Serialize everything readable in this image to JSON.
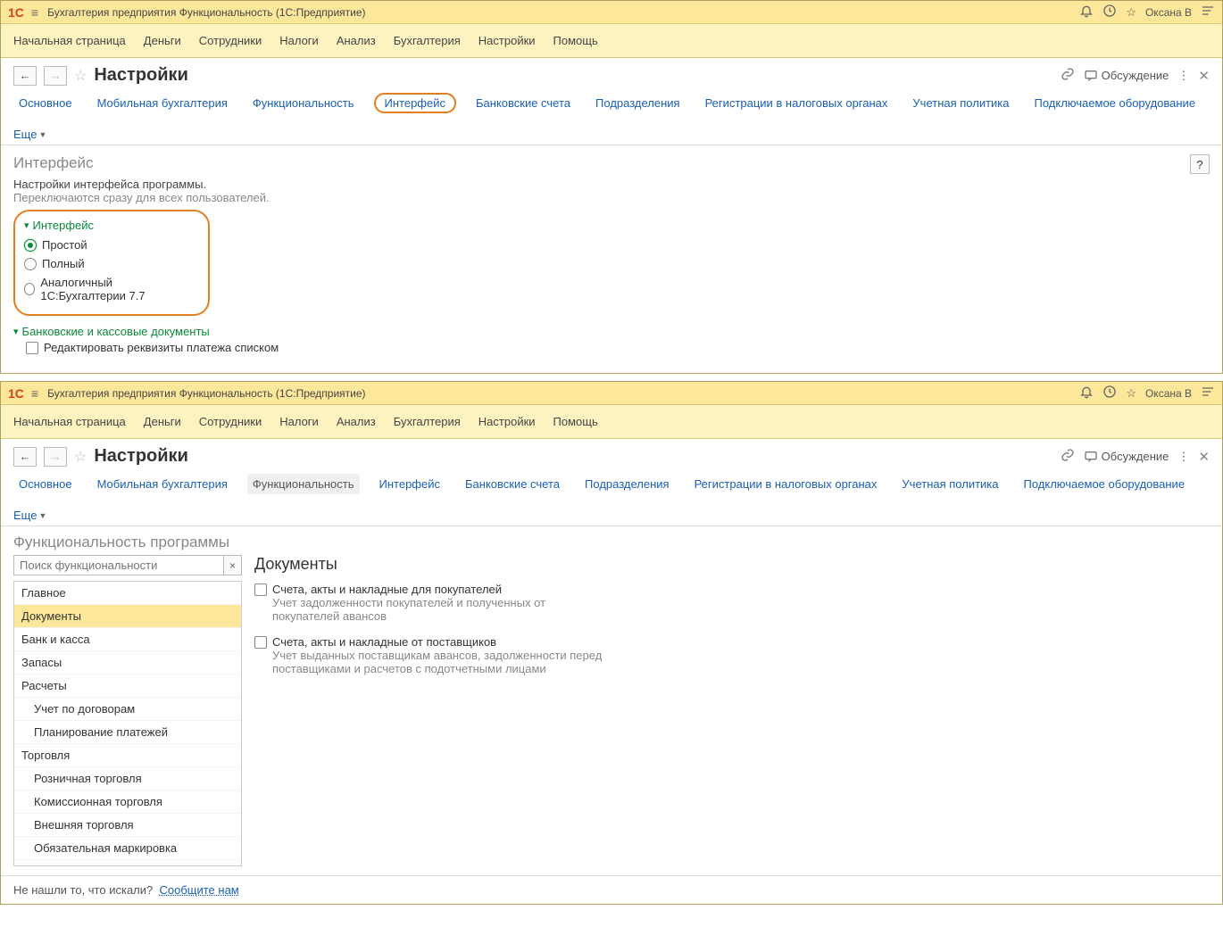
{
  "app": {
    "logo_text": "1C",
    "title": "Бухгалтерия предприятия Функциональность  (1С:Предприятие)",
    "user": "Оксана В",
    "mainmenu": [
      "Начальная страница",
      "Деньги",
      "Сотрудники",
      "Налоги",
      "Анализ",
      "Бухгалтерия",
      "Настройки",
      "Помощь"
    ]
  },
  "page": {
    "title": "Настройки",
    "discussion": "Обсуждение",
    "tabs": [
      "Основное",
      "Мобильная бухгалтерия",
      "Функциональность",
      "Интерфейс",
      "Банковские счета",
      "Подразделения",
      "Регистрации в налоговых органах",
      "Учетная политика",
      "Подключаемое оборудование"
    ],
    "more": "Еще"
  },
  "win1": {
    "heading": "Интерфейс",
    "desc1": "Настройки интерфейса программы.",
    "desc2": "Переключаются сразу для всех пользователей.",
    "help": "?",
    "group1_title": "Интерфейс",
    "radios": [
      "Простой",
      "Полный",
      "Аналогичный 1С:Бухгалтерии 7.7"
    ],
    "group2_title": "Банковские и кассовые документы",
    "chk1": "Редактировать реквизиты платежа списком"
  },
  "win2": {
    "heading": "Функциональность программы",
    "search_placeholder": "Поиск функциональности",
    "clear": "×",
    "tree": [
      "Главное",
      "Документы",
      "Банк и касса",
      "Запасы",
      "Расчеты",
      "Учет по договорам",
      "Планирование платежей",
      "Торговля",
      "Розничная торговля",
      "Комиссионная торговля",
      "Внешняя торговля",
      "Обязательная маркировка"
    ],
    "tree_indent": [
      false,
      false,
      false,
      false,
      false,
      true,
      true,
      false,
      true,
      true,
      true,
      true
    ],
    "tree_selected": 1,
    "right_heading": "Документы",
    "opts": [
      {
        "label": "Счета, акты и накладные для покупателей",
        "desc": "Учет задолженности покупателей и полученных от покупателей авансов"
      },
      {
        "label": "Счета, акты и накладные от поставщиков",
        "desc": "Учет выданных поставщикам авансов, задолженности перед поставщиками и расчетов с подотчетными лицами"
      }
    ],
    "footer_q": "Не нашли то, что искали?",
    "footer_link": "Сообщите нам"
  }
}
